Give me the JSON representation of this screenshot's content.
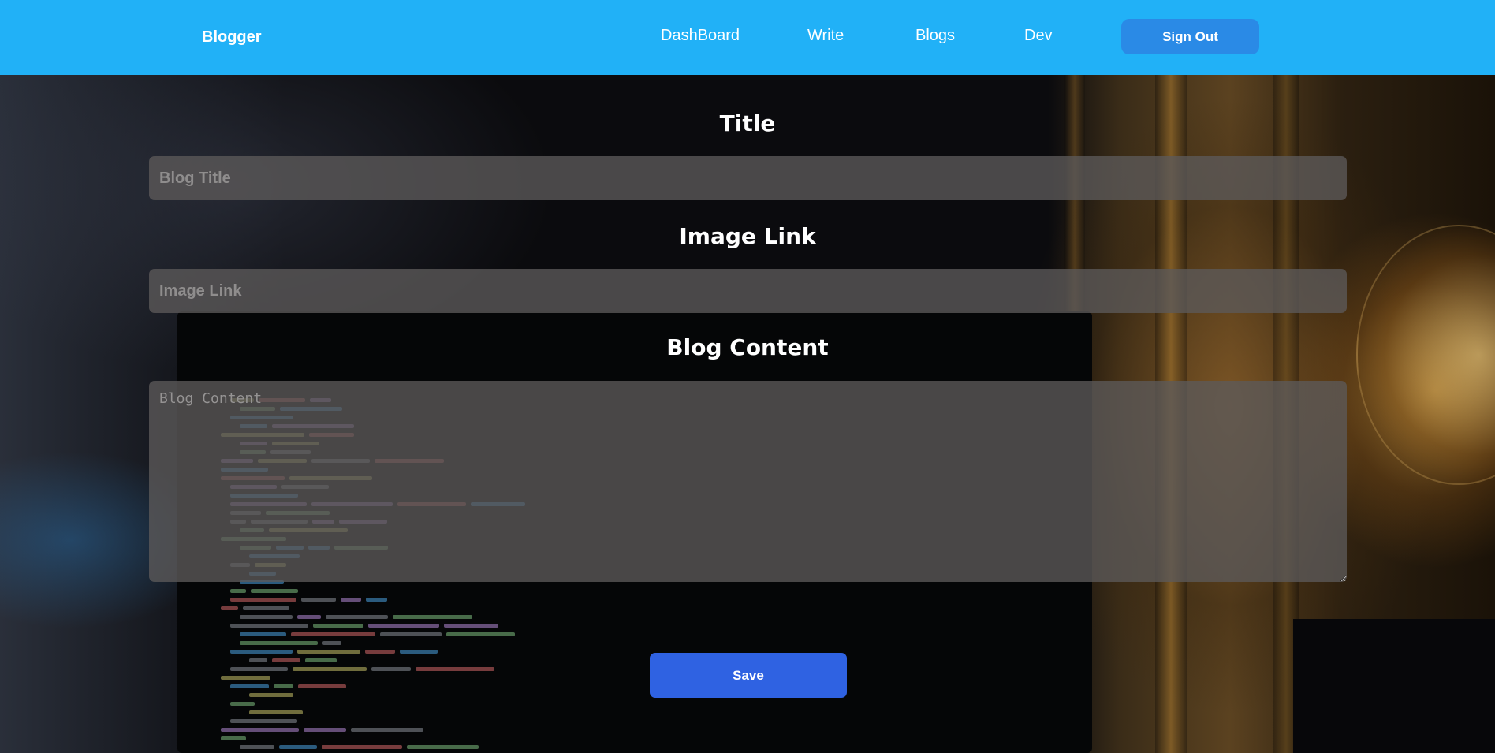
{
  "header": {
    "brand": "Blogger",
    "nav": [
      {
        "label": "DashBoard"
      },
      {
        "label": "Write"
      },
      {
        "label": "Blogs"
      },
      {
        "label": "Dev"
      }
    ],
    "sign_out_label": "Sign Out"
  },
  "form": {
    "title": {
      "heading": "Title",
      "placeholder": "Blog Title",
      "value": ""
    },
    "image": {
      "heading": "Image Link",
      "placeholder": "Image Link",
      "value": ""
    },
    "content": {
      "heading": "Blog Content",
      "placeholder": "Blog Content",
      "value": ""
    },
    "save_label": "Save"
  },
  "colors": {
    "header_bg": "#21b1f7",
    "sign_out_bg": "#2a8ae6",
    "save_bg": "#2f62e2"
  }
}
